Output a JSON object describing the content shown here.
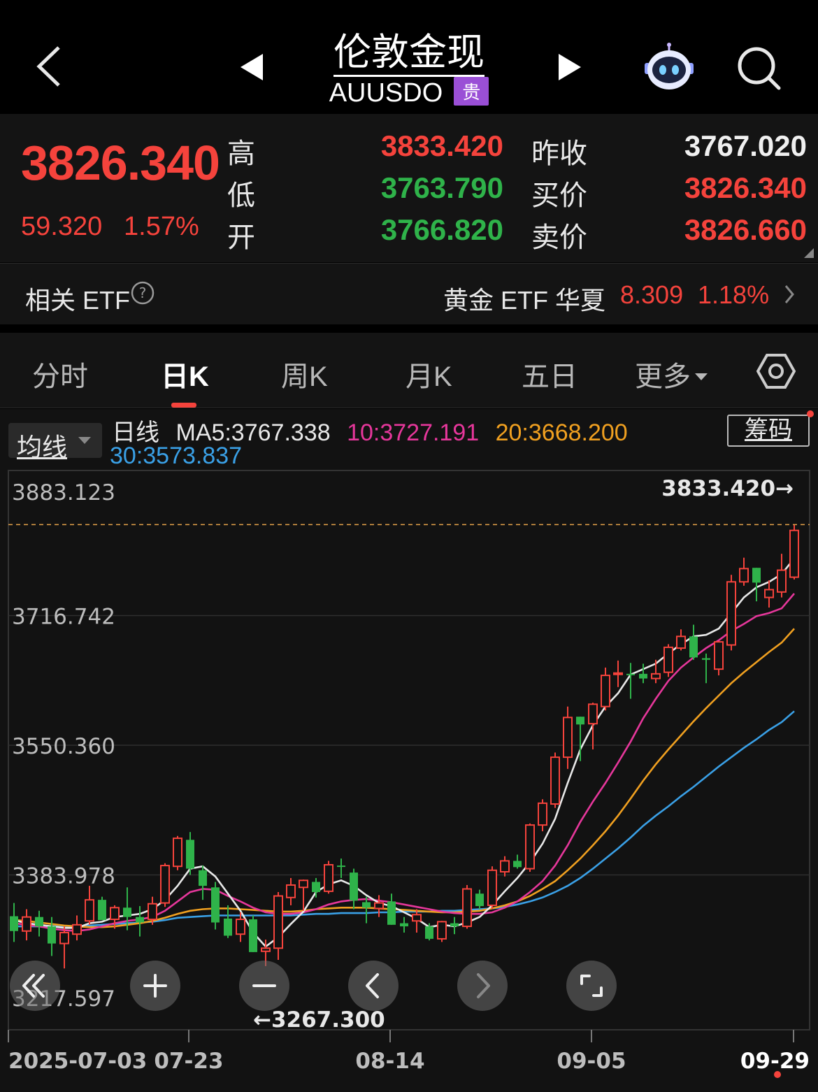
{
  "header": {
    "title": "伦敦金现",
    "code": "AUUSDO",
    "badge": "贵"
  },
  "quote": {
    "price": "3826.340",
    "change": "59.320",
    "change_pct": "1.57%",
    "labels": {
      "high": "高",
      "low": "低",
      "open": "开",
      "prev_close": "昨收",
      "bid": "买价",
      "ask": "卖价"
    },
    "high": "3833.420",
    "low": "3763.790",
    "open": "3766.820",
    "prev_close": "3767.020",
    "bid": "3826.340",
    "ask": "3826.660"
  },
  "etf": {
    "label": "相关 ETF",
    "name": "黄金 ETF 华夏",
    "price": "8.309",
    "pct": "1.18%"
  },
  "tabs": [
    "分时",
    "日K",
    "周K",
    "月K",
    "五日",
    "更多"
  ],
  "active_tab": "日K",
  "ma_bar": {
    "select_label": "均线",
    "prefix": "日线",
    "ma5": "MA5:3767.338",
    "ma10": "10:3727.191",
    "ma20": "20:3668.200",
    "ma30": "30:3573.837",
    "chip_button": "筹码"
  },
  "colors": {
    "up": "#f5433c",
    "down": "#2fb34a",
    "ma5": "#e8e8e8",
    "ma10": "#e6379b",
    "ma20": "#f0a020",
    "ma30": "#3aa0e6"
  },
  "controls": [
    "rewind-icon",
    "zoom-in-icon",
    "zoom-out-icon",
    "prev-icon",
    "next-icon",
    "fullscreen-icon"
  ],
  "chart_data": {
    "type": "candlestick",
    "y_ticks": [
      "3883.123",
      "3716.742",
      "3550.360",
      "3383.978",
      "3217.597"
    ],
    "x_ticks": [
      "2025-07-03",
      "07-23",
      "08-14",
      "09-05",
      "09-29"
    ],
    "ylim": [
      3217.597,
      3883.123
    ],
    "high_marker": "3833.420→",
    "low_marker": "←3267.300",
    "candles": [
      {
        "o": 3331,
        "h": 3348,
        "l": 3298,
        "c": 3312
      },
      {
        "o": 3312,
        "h": 3340,
        "l": 3300,
        "c": 3330
      },
      {
        "o": 3330,
        "h": 3338,
        "l": 3305,
        "c": 3318
      },
      {
        "o": 3318,
        "h": 3330,
        "l": 3280,
        "c": 3296
      },
      {
        "o": 3296,
        "h": 3318,
        "l": 3264,
        "c": 3310
      },
      {
        "o": 3308,
        "h": 3332,
        "l": 3300,
        "c": 3320
      },
      {
        "o": 3325,
        "h": 3370,
        "l": 3320,
        "c": 3352
      },
      {
        "o": 3352,
        "h": 3356,
        "l": 3326,
        "c": 3326
      },
      {
        "o": 3327,
        "h": 3345,
        "l": 3315,
        "c": 3342
      },
      {
        "o": 3342,
        "h": 3368,
        "l": 3313,
        "c": 3330
      },
      {
        "o": 3330,
        "h": 3344,
        "l": 3305,
        "c": 3323
      },
      {
        "o": 3327,
        "h": 3356,
        "l": 3320,
        "c": 3347
      },
      {
        "o": 3348,
        "h": 3399,
        "l": 3343,
        "c": 3396
      },
      {
        "o": 3395,
        "h": 3434,
        "l": 3390,
        "c": 3431
      },
      {
        "o": 3429,
        "h": 3439,
        "l": 3384,
        "c": 3392
      },
      {
        "o": 3390,
        "h": 3396,
        "l": 3352,
        "c": 3370
      },
      {
        "o": 3368,
        "h": 3375,
        "l": 3314,
        "c": 3323
      },
      {
        "o": 3328,
        "h": 3345,
        "l": 3303,
        "c": 3306
      },
      {
        "o": 3308,
        "h": 3336,
        "l": 3298,
        "c": 3327
      },
      {
        "o": 3327,
        "h": 3332,
        "l": 3285,
        "c": 3285
      },
      {
        "o": 3286,
        "h": 3301,
        "l": 3267,
        "c": 3290
      },
      {
        "o": 3290,
        "h": 3362,
        "l": 3275,
        "c": 3357
      },
      {
        "o": 3355,
        "h": 3380,
        "l": 3345,
        "c": 3371
      },
      {
        "o": 3368,
        "h": 3378,
        "l": 3338,
        "c": 3377
      },
      {
        "o": 3375,
        "h": 3380,
        "l": 3355,
        "c": 3362
      },
      {
        "o": 3363,
        "h": 3402,
        "l": 3360,
        "c": 3397
      },
      {
        "o": 3396,
        "h": 3405,
        "l": 3380,
        "c": 3395
      },
      {
        "o": 3387,
        "h": 3392,
        "l": 3340,
        "c": 3351
      },
      {
        "o": 3349,
        "h": 3356,
        "l": 3322,
        "c": 3342
      },
      {
        "o": 3341,
        "h": 3358,
        "l": 3330,
        "c": 3348
      },
      {
        "o": 3350,
        "h": 3360,
        "l": 3320,
        "c": 3320
      },
      {
        "o": 3322,
        "h": 3330,
        "l": 3310,
        "c": 3318
      },
      {
        "o": 3325,
        "h": 3340,
        "l": 3310,
        "c": 3333
      },
      {
        "o": 3318,
        "h": 3322,
        "l": 3300,
        "c": 3302
      },
      {
        "o": 3302,
        "h": 3325,
        "l": 3298,
        "c": 3324
      },
      {
        "o": 3322,
        "h": 3330,
        "l": 3308,
        "c": 3318
      },
      {
        "o": 3318,
        "h": 3371,
        "l": 3315,
        "c": 3366
      },
      {
        "o": 3360,
        "h": 3365,
        "l": 3340,
        "c": 3344
      },
      {
        "o": 3345,
        "h": 3395,
        "l": 3340,
        "c": 3390
      },
      {
        "o": 3388,
        "h": 3408,
        "l": 3382,
        "c": 3402
      },
      {
        "o": 3402,
        "h": 3410,
        "l": 3392,
        "c": 3394
      },
      {
        "o": 3392,
        "h": 3450,
        "l": 3388,
        "c": 3448
      },
      {
        "o": 3448,
        "h": 3481,
        "l": 3440,
        "c": 3476
      },
      {
        "o": 3475,
        "h": 3541,
        "l": 3470,
        "c": 3535
      },
      {
        "o": 3535,
        "h": 3600,
        "l": 3520,
        "c": 3586
      },
      {
        "o": 3587,
        "h": 3578,
        "l": 3530,
        "c": 3577
      },
      {
        "o": 3578,
        "h": 3605,
        "l": 3545,
        "c": 3603
      },
      {
        "o": 3600,
        "h": 3650,
        "l": 3595,
        "c": 3640
      },
      {
        "o": 3643,
        "h": 3659,
        "l": 3625,
        "c": 3643
      },
      {
        "o": 3642,
        "h": 3656,
        "l": 3610,
        "c": 3641
      },
      {
        "o": 3642,
        "h": 3655,
        "l": 3630,
        "c": 3636
      },
      {
        "o": 3636,
        "h": 3660,
        "l": 3630,
        "c": 3642
      },
      {
        "o": 3644,
        "h": 3680,
        "l": 3638,
        "c": 3676
      },
      {
        "o": 3675,
        "h": 3699,
        "l": 3672,
        "c": 3690
      },
      {
        "o": 3690,
        "h": 3705,
        "l": 3660,
        "c": 3663
      },
      {
        "o": 3662,
        "h": 3668,
        "l": 3630,
        "c": 3660
      },
      {
        "o": 3648,
        "h": 3684,
        "l": 3640,
        "c": 3683
      },
      {
        "o": 3679,
        "h": 3769,
        "l": 3672,
        "c": 3760
      },
      {
        "o": 3760,
        "h": 3791,
        "l": 3755,
        "c": 3777
      },
      {
        "o": 3778,
        "h": 3763,
        "l": 3735,
        "c": 3759
      },
      {
        "o": 3740,
        "h": 3762,
        "l": 3727,
        "c": 3750
      },
      {
        "o": 3747,
        "h": 3796,
        "l": 3740,
        "c": 3775
      },
      {
        "o": 3766,
        "h": 3833,
        "l": 3763,
        "c": 3826
      }
    ],
    "ma5": [
      3326,
      3322,
      3320,
      3318,
      3316,
      3316,
      3322,
      3324,
      3330,
      3332,
      3334,
      3340,
      3352,
      3370,
      3392,
      3395,
      3382,
      3360,
      3338,
      3310,
      3292,
      3304,
      3321,
      3337,
      3362,
      3372,
      3377,
      3370,
      3358,
      3348,
      3344,
      3336,
      3328,
      3317,
      3320,
      3318,
      3323,
      3330,
      3345,
      3363,
      3380,
      3400,
      3424,
      3456,
      3502,
      3545,
      3576,
      3600,
      3617,
      3641,
      3648,
      3655,
      3668,
      3680,
      3690,
      3692,
      3700,
      3720,
      3740,
      3753,
      3760,
      3770,
      3790
    ],
    "ma10": [
      3322,
      3320,
      3318,
      3315,
      3313,
      3312,
      3314,
      3318,
      3322,
      3325,
      3327,
      3330,
      3338,
      3350,
      3362,
      3366,
      3365,
      3357,
      3350,
      3342,
      3336,
      3334,
      3334,
      3336,
      3340,
      3346,
      3350,
      3352,
      3353,
      3351,
      3349,
      3346,
      3343,
      3340,
      3337,
      3335,
      3334,
      3334,
      3336,
      3342,
      3350,
      3362,
      3376,
      3396,
      3422,
      3452,
      3478,
      3502,
      3528,
      3555,
      3585,
      3610,
      3633,
      3650,
      3663,
      3675,
      3685,
      3697,
      3706,
      3716,
      3720,
      3726,
      3745
    ],
    "ma20": [
      3326,
      3325,
      3323,
      3321,
      3319,
      3318,
      3317,
      3317,
      3318,
      3320,
      3322,
      3325,
      3329,
      3334,
      3338,
      3340,
      3341,
      3341,
      3340,
      3339,
      3338,
      3337,
      3337,
      3338,
      3340,
      3341,
      3342,
      3342,
      3342,
      3341,
      3340,
      3339,
      3338,
      3337,
      3336,
      3336,
      3337,
      3338,
      3341,
      3345,
      3350,
      3357,
      3366,
      3376,
      3390,
      3405,
      3422,
      3440,
      3460,
      3482,
      3505,
      3526,
      3545,
      3563,
      3581,
      3598,
      3614,
      3630,
      3644,
      3657,
      3670,
      3682,
      3700
    ],
    "ma30": [
      3318,
      3318,
      3318,
      3318,
      3318,
      3318,
      3319,
      3320,
      3321,
      3322,
      3323,
      3324,
      3326,
      3329,
      3330,
      3331,
      3332,
      3332,
      3332,
      3332,
      3332,
      3332,
      3332,
      3333,
      3334,
      3334,
      3335,
      3335,
      3335,
      3336,
      3336,
      3337,
      3337,
      3337,
      3338,
      3338,
      3339,
      3340,
      3341,
      3343,
      3346,
      3350,
      3355,
      3362,
      3370,
      3380,
      3392,
      3405,
      3418,
      3432,
      3447,
      3460,
      3472,
      3485,
      3497,
      3510,
      3523,
      3535,
      3547,
      3558,
      3570,
      3580,
      3594
    ]
  }
}
